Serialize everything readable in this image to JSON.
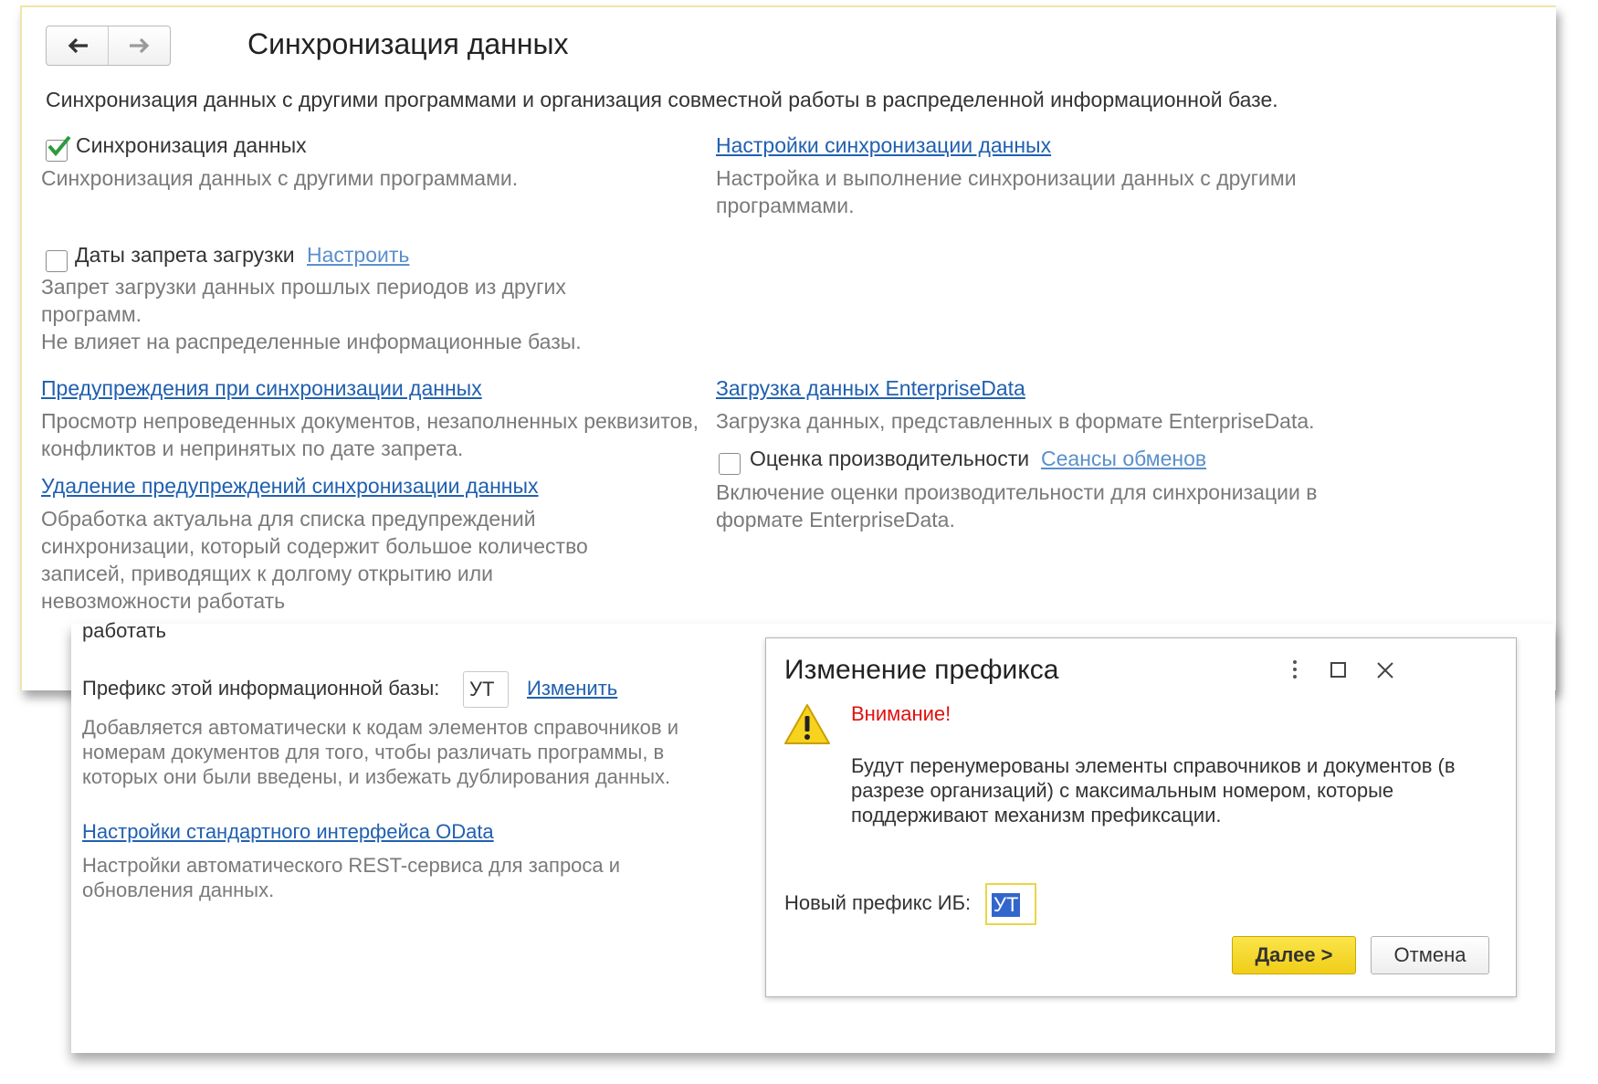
{
  "header": {
    "back_icon": "arrow-left-icon",
    "forward_icon": "arrow-right-icon",
    "title": "Синхронизация данных"
  },
  "intro": "Синхронизация данных с другими программами и организация совместной работы в распределенной информационной базе.",
  "sync": {
    "checked": true,
    "label": "Синхронизация данных",
    "description": "Синхронизация данных с другими программами."
  },
  "sync_settings": {
    "link": "Настройки синхронизации данных",
    "description": "Настройка и выполнение синхронизации данных с другими программами."
  },
  "import_ban": {
    "checked": false,
    "label": "Даты запрета загрузки",
    "link": "Настроить",
    "description_1": "Запрет загрузки данных прошлых периодов из других программ.",
    "description_2": "Не влияет на распределенные информационные базы."
  },
  "warnings": {
    "link": "Предупреждения при синхронизации данных",
    "description": "Просмотр непроведенных документов, незаполненных реквизитов, конфликтов и непринятых по дате запрета."
  },
  "delete_warnings": {
    "link": "Удаление предупреждений синхронизации данных",
    "description": "Обработка актуальна для списка предупреждений синхронизации, который содержит большое количество записей, приводящих к долгому открытию или невозможности работать"
  },
  "enterprise_data": {
    "link": "Загрузка данных EnterpriseData",
    "description": "Загрузка данных, представленных в формате EnterpriseData."
  },
  "performance": {
    "checked": false,
    "label": "Оценка производительности",
    "link": "Сеансы обменов",
    "description": "Включение оценки производительности для синхронизации в формате EnterpriseData."
  },
  "prefix": {
    "overflow_text": "работать",
    "label": "Префикс этой информационной базы:",
    "value": "УТ",
    "change_link": "Изменить",
    "description": "Добавляется автоматически к кодам элементов справочников и номерам документов для того, чтобы различать программы, в которых они были введены, и избежать дублирования данных."
  },
  "odata": {
    "link": "Настройки стандартного интерфейса OData",
    "description": "Настройки автоматического REST-сервиса для запроса и обновления данных."
  },
  "dialog": {
    "title": "Изменение префикса",
    "more_icon": "more-vertical-icon",
    "maximize_icon": "maximize-icon",
    "close_icon": "close-icon",
    "warning_icon": "warning-triangle-icon",
    "warning_title": "Внимание!",
    "body": "Будут перенумерованы элементы справочников и документов (в разрезе организаций) с максимальным номером, которые поддерживают механизм префиксации.",
    "new_prefix_label": "Новый префикс ИБ:",
    "new_prefix_value": "УТ",
    "next_button": "Далее >",
    "cancel_button": "Отмена"
  },
  "colors": {
    "link": "#2060b0",
    "link_light": "#5a8fcc",
    "warning": "#e01010",
    "accent_yellow": "#f5d423",
    "checkmark": "#2e9a3e"
  }
}
